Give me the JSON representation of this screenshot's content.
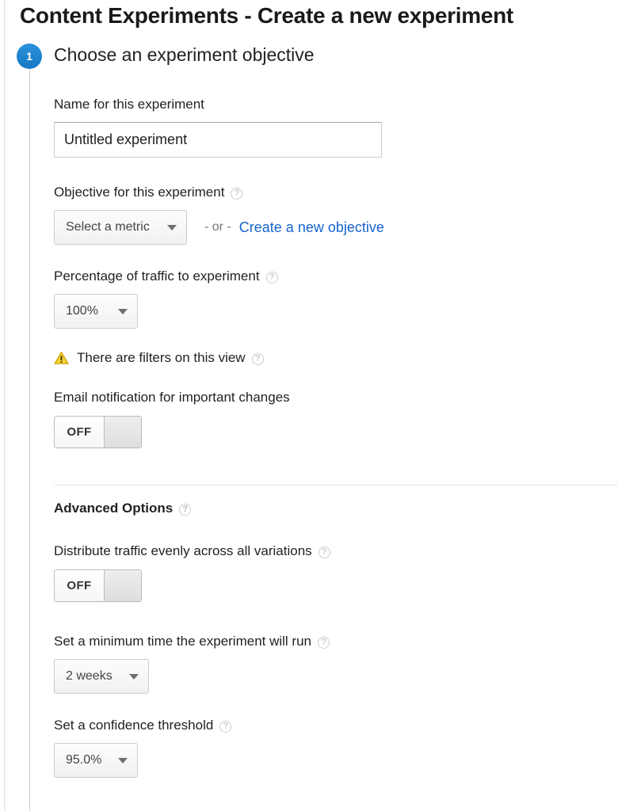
{
  "page": {
    "title": "Content Experiments - Create a new experiment"
  },
  "step": {
    "number": "1",
    "title": "Choose an experiment objective"
  },
  "icons": {
    "help": "?",
    "warning": "warning-triangle-icon",
    "caret": "chevron-down-icon"
  },
  "colors": {
    "step_badge": "#1a83d0",
    "link": "#1763cf",
    "warning": "#f5c518",
    "help_outline": "#cccccc",
    "divider": "#e6e6e6"
  },
  "fields": {
    "name": {
      "label": "Name for this experiment",
      "value": "Untitled experiment",
      "placeholder": "Untitled experiment"
    },
    "objective": {
      "label": "Objective for this experiment",
      "help": "?",
      "dropdown_value": "Select a metric",
      "separator": "- or -",
      "link_label": "Create a new objective"
    },
    "traffic": {
      "label": "Percentage of traffic to experiment",
      "help": "?",
      "dropdown_value": "100%"
    },
    "filters_notice": {
      "text": "There are filters on this view",
      "help": "?"
    },
    "email": {
      "label": "Email notification for important changes",
      "toggle_state": "OFF"
    }
  },
  "advanced": {
    "heading": "Advanced Options",
    "help": "?",
    "distribute": {
      "label": "Distribute traffic evenly across all variations",
      "help": "?",
      "toggle_state": "OFF"
    },
    "min_time": {
      "label": "Set a minimum time the experiment will run",
      "help": "?",
      "dropdown_value": "2 weeks"
    },
    "confidence": {
      "label": "Set a confidence threshold",
      "help": "?",
      "dropdown_value": "95.0%"
    }
  }
}
